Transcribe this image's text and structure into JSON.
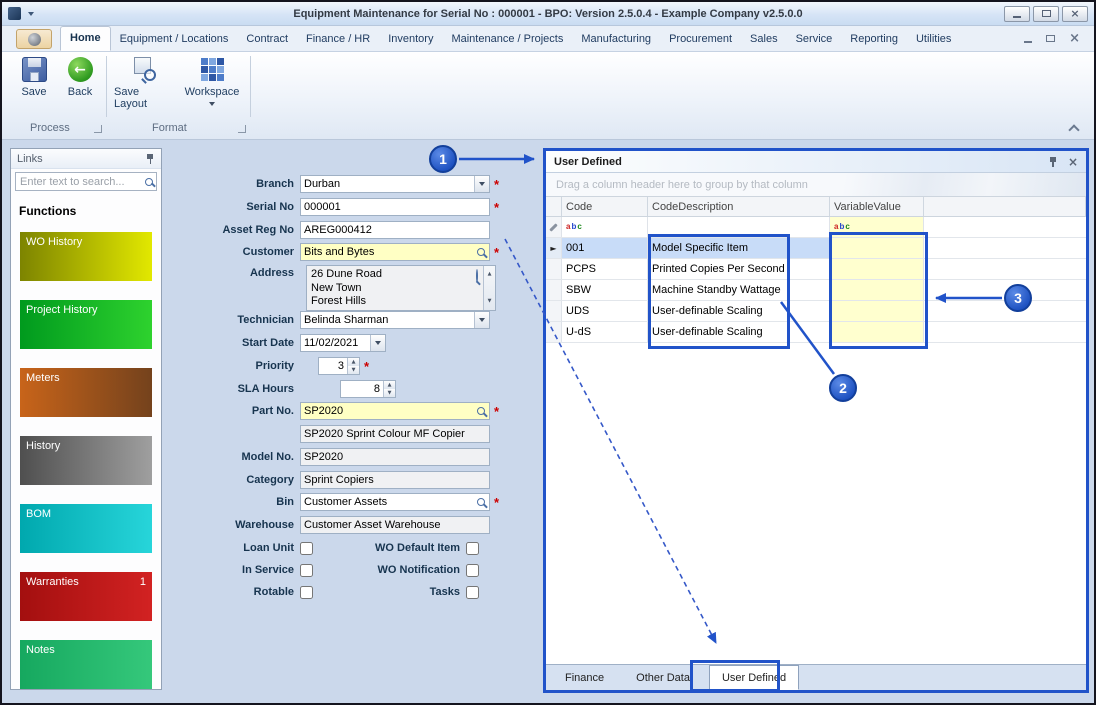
{
  "titlebar": {
    "title": "Equipment Maintenance for Serial No : 000001 - BPO: Version 2.5.0.4 - Example Company v2.5.0.0"
  },
  "ribbon": {
    "tabs": [
      "Home",
      "Equipment / Locations",
      "Contract",
      "Finance / HR",
      "Inventory",
      "Maintenance / Projects",
      "Manufacturing",
      "Procurement",
      "Sales",
      "Service",
      "Reporting",
      "Utilities"
    ],
    "active_tab": "Home",
    "buttons": {
      "save": "Save",
      "back": "Back",
      "save_layout": "Save Layout",
      "workspace": "Workspace"
    },
    "groups": {
      "process": "Process",
      "format": "Format"
    }
  },
  "links": {
    "title": "Links",
    "search_placeholder": "Enter text to search...",
    "heading": "Functions",
    "items": [
      {
        "label": "WO History",
        "badge": "",
        "from": "#7d8400",
        "to": "#e2e800"
      },
      {
        "label": "Project History",
        "badge": "",
        "from": "#009a1e",
        "to": "#2ed22e"
      },
      {
        "label": "Meters",
        "badge": "",
        "from": "#c8641a",
        "to": "#74421c"
      },
      {
        "label": "History",
        "badge": "",
        "from": "#4f4f4f",
        "to": "#9f9f9f"
      },
      {
        "label": "BOM",
        "badge": "",
        "from": "#00a8ae",
        "to": "#27d5da"
      },
      {
        "label": "Warranties",
        "badge": "1",
        "from": "#a30f0f",
        "to": "#d22222"
      },
      {
        "label": "Notes",
        "badge": "",
        "from": "#16a85f",
        "to": "#35c87b"
      }
    ]
  },
  "form": {
    "branch": {
      "label": "Branch",
      "value": "Durban",
      "required": "*"
    },
    "serial_no": {
      "label": "Serial No",
      "value": "000001",
      "required": "*"
    },
    "asset_reg_no": {
      "label": "Asset Reg No",
      "value": "AREG000412"
    },
    "customer": {
      "label": "Customer",
      "value": "Bits and Bytes",
      "required": "*"
    },
    "address": {
      "label": "Address",
      "lines": [
        "26 Dune Road",
        "New Town",
        "Forest Hills"
      ]
    },
    "technician": {
      "label": "Technician",
      "value": "Belinda Sharman"
    },
    "start_date": {
      "label": "Start Date",
      "value": "11/02/2021"
    },
    "priority": {
      "label": "Priority",
      "value": "3",
      "required": "*"
    },
    "sla_hours": {
      "label": "SLA Hours",
      "value": "8"
    },
    "part_no": {
      "label": "Part No.",
      "value": "SP2020",
      "required": "*"
    },
    "part_description": {
      "value": "SP2020 Sprint Colour MF Copier"
    },
    "model_no": {
      "label": "Model No.",
      "value": "SP2020"
    },
    "category": {
      "label": "Category",
      "value": "Sprint Copiers"
    },
    "bin": {
      "label": "Bin",
      "value": "Customer Assets",
      "required": "*"
    },
    "warehouse": {
      "label": "Warehouse",
      "value": "Customer Asset Warehouse"
    },
    "checkboxes": {
      "loan_unit": "Loan Unit",
      "wo_default_item": "WO Default Item",
      "in_service": "In Service",
      "wo_notification": "WO Notification",
      "rotable": "Rotable",
      "tasks": "Tasks"
    }
  },
  "user_defined": {
    "title": "User Defined",
    "group_hint": "Drag a column header here to group by that column",
    "columns": {
      "code": "Code",
      "description": "CodeDescription",
      "value": "VariableValue"
    },
    "rows": [
      {
        "code": "001",
        "description": "Model Specific Item",
        "value": ""
      },
      {
        "code": "PCPS",
        "description": "Printed Copies Per Second",
        "value": ""
      },
      {
        "code": "SBW",
        "description": "Machine Standby Wattage",
        "value": ""
      },
      {
        "code": "UDS",
        "description": "User-definable Scaling",
        "value": ""
      },
      {
        "code": "U-dS",
        "description": "User-definable Scaling",
        "value": ""
      }
    ],
    "tabs": [
      "Finance",
      "Other Data",
      "User Defined"
    ],
    "active_tab": "User Defined"
  },
  "annotations": {
    "labels": [
      "1",
      "2",
      "3"
    ],
    "accent": "#2153c9"
  }
}
